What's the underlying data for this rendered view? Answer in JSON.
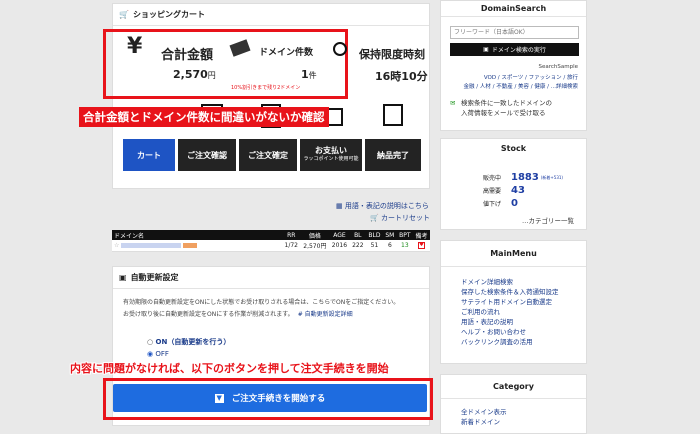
{
  "cart": {
    "title": "ショッピングカート",
    "total_label": "合計金額",
    "total_value": "2,570",
    "total_unit": "円",
    "count_label": "ドメイン件数",
    "count_value": "1",
    "count_unit": "件",
    "discount_note": "10%割引きまで残り2ドメイン",
    "hold_label": "保持限度時刻",
    "hold_value": "16時10分",
    "callout_text": "合計金額とドメイン件数に間違いがないか確認"
  },
  "steps": [
    {
      "label": "カート",
      "sub": ""
    },
    {
      "label": "ご注文確認",
      "sub": ""
    },
    {
      "label": "ご注文確定",
      "sub": ""
    },
    {
      "label": "お支払い",
      "sub": "ラッコポイント使用可能"
    },
    {
      "label": "納品完了",
      "sub": ""
    }
  ],
  "links": {
    "help": "用語・表記の説明はこちら",
    "reset": "カートリセット"
  },
  "table": {
    "headers": [
      "ドメイン名",
      "RR",
      "価格",
      "AGE",
      "BL",
      "BLD",
      "SM",
      "BPT",
      "備考"
    ],
    "row": {
      "rr": "1/72",
      "price": "2,570円",
      "age": "2016",
      "bl": "222",
      "bld": "51",
      "sm": "6",
      "bpt": "13"
    }
  },
  "auto_renew": {
    "title": "自動更新設定",
    "text1": "有効期限の自動更新設定をONにした状態でお受け取りされる場合は、こちらでONをご指定ください。",
    "text2": "お受け取り後に自動更新設定をONにする作業が削減されます。",
    "detail_link": "# 自動更新設定詳細",
    "on_label": "ON（自動更新を行う）",
    "off_label": "OFF"
  },
  "bottom": {
    "callout_text": "内容に問題がなければ、以下のボタンを押して注文手続きを開始",
    "start_button": "ご注文手続きを開始する"
  },
  "sidebar": {
    "domain_search": {
      "title": "DomainSearch",
      "placeholder": "フリーワード（日本語OK）",
      "button": "ドメイン検索の実行",
      "sample_title": "SearchSample",
      "sample_line1": "VOD / スポーツ / ファッション / 旅行",
      "sample_line2": "金融 / 人材 / 不動産 / 美容 / 健康 / ...詳細検索",
      "notify_line1": "検索条件に一致したドメインの",
      "notify_line2": "入荷情報をメールで受け取る"
    },
    "stock": {
      "title": "Stock",
      "rows": [
        {
          "label": "販売中",
          "value": "1883",
          "note": "(新着+531)"
        },
        {
          "label": "高需要",
          "value": "43",
          "note": ""
        },
        {
          "label": "値下げ",
          "value": "0",
          "note": ""
        }
      ],
      "category_link": "…カテゴリー一覧"
    },
    "main_menu": {
      "title": "MainMenu",
      "items": [
        "ドメイン詳細検索",
        "保存した検索条件＆入荷通知設定",
        "サテライト用ドメイン自動選定",
        "ご利用の流れ",
        "用語・表記の説明",
        "ヘルプ・お問い合わせ",
        "バックリンク調査の活用"
      ]
    },
    "category": {
      "title": "Category",
      "items": [
        "全ドメイン表示",
        "新着ドメイン"
      ]
    }
  },
  "colors": {
    "accent": "#1e54c4",
    "highlight": "#e8131a",
    "dark": "#232323"
  }
}
